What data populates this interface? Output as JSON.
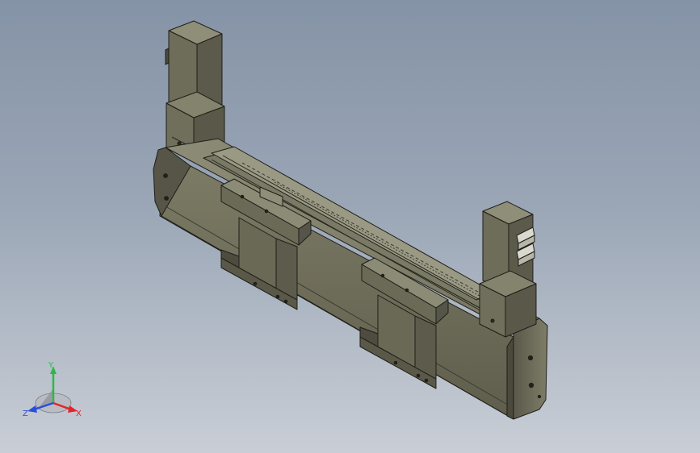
{
  "viewport": {
    "background_top": "#8593a6",
    "background_bottom": "#c9ced6"
  },
  "model": {
    "body_color": "#6f6e5c",
    "body_shadow": "#4d4c3e",
    "body_light": "#8c8b75",
    "edge_color": "#1e1e18"
  },
  "triad": {
    "x_label": "X",
    "y_label": "Y",
    "z_label": "Z",
    "x_color": "#e0262b",
    "y_color": "#2fb84a",
    "z_color": "#2a4fd6"
  }
}
